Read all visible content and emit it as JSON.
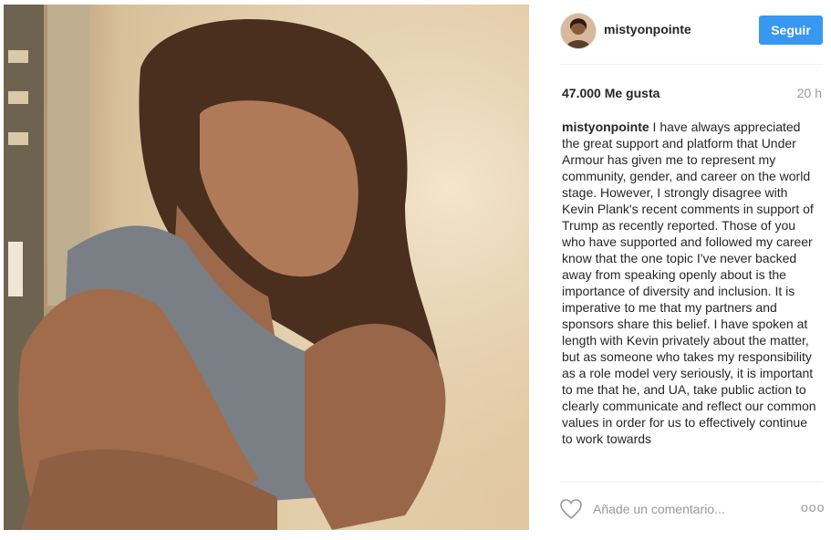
{
  "post": {
    "photo_icon": "portrait-photo",
    "username": "mistyonpointe",
    "follow_label": "Seguir",
    "likes": "47.000 Me gusta",
    "time": "20 h",
    "caption_username": "mistyonpointe",
    "caption_text": " I have always appreciated the great support and platform that Under Armour has given me to represent my community, gender, and career on the world stage. However, I strongly disagree with Kevin Plank's recent comments in support of Trump as recently reported. Those of you who have supported and followed my career know that the one topic I've never backed away from speaking openly about is the importance of diversity and inclusion. It is imperative to me that my partners and sponsors share this belief. I have spoken at length with Kevin privately about the matter, but as someone who takes my responsibility as a role model very seriously, it is important to me that he, and UA, take public action to clearly communicate and reflect our common values in order for us to effectively continue to work towards",
    "comment_placeholder": "Añade un comentario...",
    "more_label": "ooo",
    "like_icon": "heart-outline-icon"
  },
  "colors": {
    "follow_button": "#3897f0",
    "text": "#262626",
    "muted": "#999999"
  }
}
